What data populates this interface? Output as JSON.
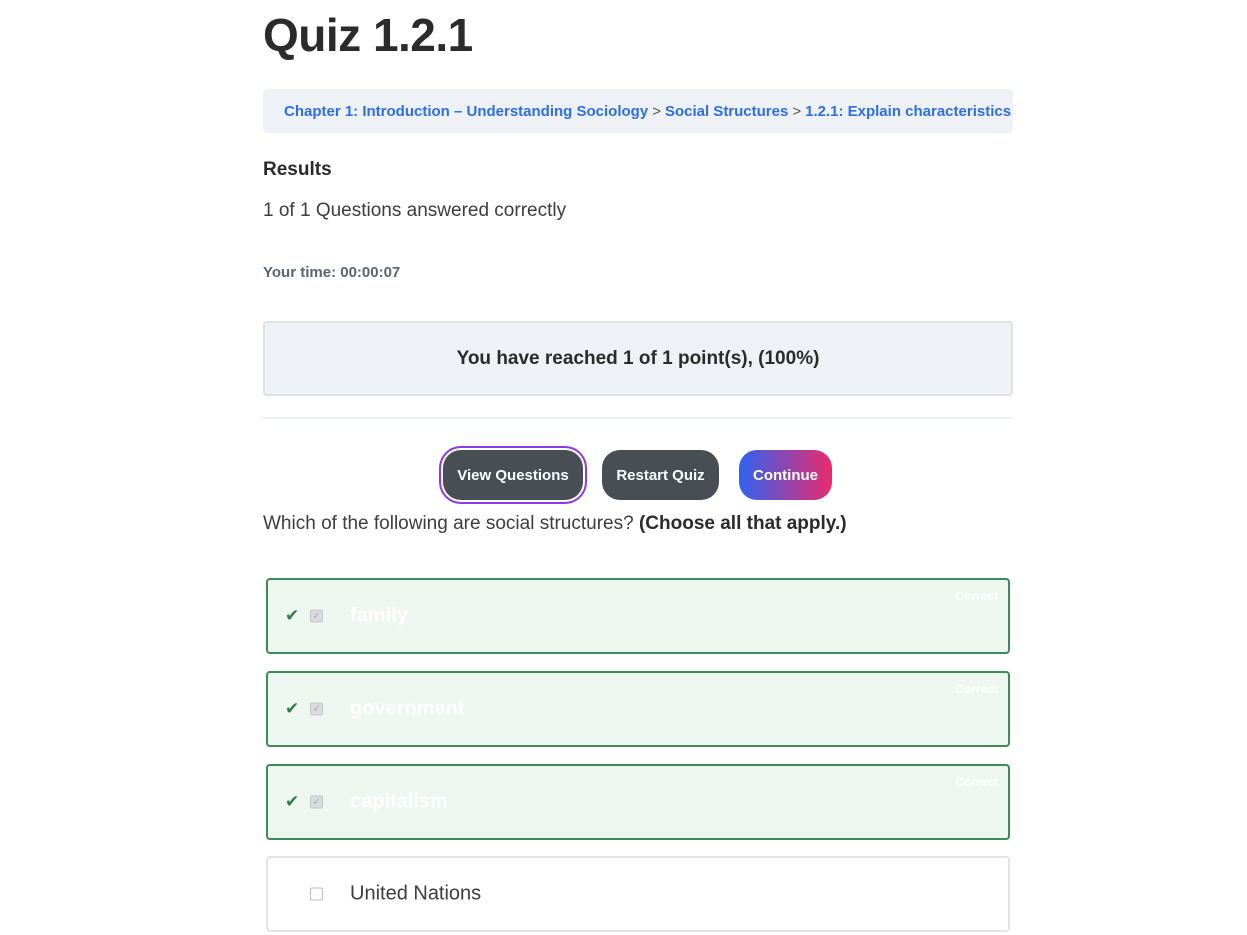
{
  "page": {
    "title": "Quiz 1.2.1"
  },
  "breadcrumb": {
    "items": [
      "Chapter 1: Introduction – Understanding Sociology",
      "Social Structures",
      "1.2.1: Explain characteristics"
    ],
    "separator": ">",
    "overflow": "…"
  },
  "results": {
    "heading": "Results",
    "answered": "1 of 1 Questions answered correctly",
    "time": "Your time: 00:00:07",
    "points": "You have reached 1 of 1 point(s), (100%)"
  },
  "buttons": {
    "view_questions": "View Questions",
    "restart_quiz": "Restart Quiz",
    "continue": "Continue"
  },
  "question": {
    "text": "Which of the following are social structures?",
    "instruction": "(Choose all that apply.)"
  },
  "options": [
    {
      "label": "family",
      "status": "Correct",
      "checked": true
    },
    {
      "label": "government",
      "status": "Correct",
      "checked": true
    },
    {
      "label": "capitalism",
      "status": "Correct",
      "checked": true
    },
    {
      "label": "United Nations",
      "status": "",
      "checked": false
    }
  ],
  "colors": {
    "link": "#2f6fe4",
    "correct_border": "#3f8a58",
    "correct_bg": "#eef6f0",
    "focus_ring": "#8d3be0",
    "continue_gradient_start": "#2f63f0",
    "continue_gradient_end": "#ec2a6c"
  },
  "icons": {
    "correct": "checkmark-icon",
    "checkbox": "checkbox-icon"
  }
}
